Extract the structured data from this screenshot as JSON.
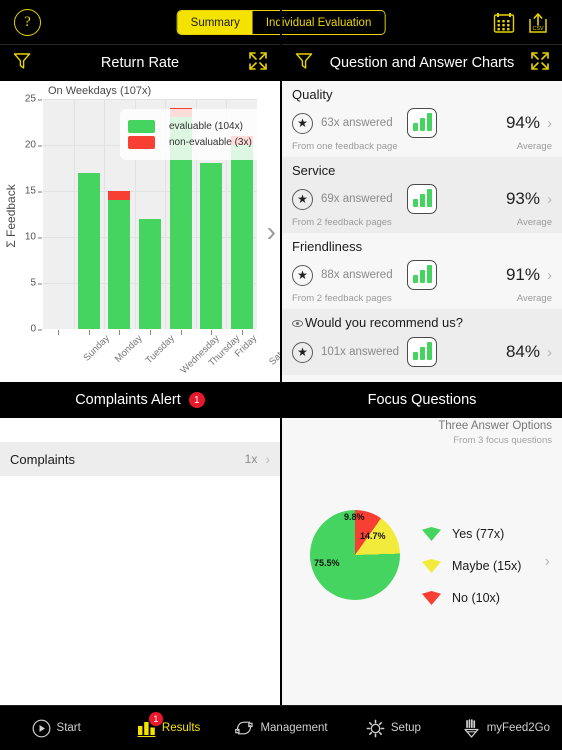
{
  "topbar": {
    "help_label": "?",
    "segments": [
      {
        "label": "Summary",
        "active": true
      },
      {
        "label": "Individual Evaluation",
        "active": false
      }
    ],
    "calendar_icon": "calendar-icon",
    "csv_icon": "csv-export-icon",
    "accent": "#F4E300"
  },
  "left_panel": {
    "header_title": "Return Rate",
    "filter_icon": "funnel-icon",
    "expand_icon": "expand-icon",
    "next_chevron": "›"
  },
  "right_panel": {
    "header_title": "Question and Answer Charts",
    "filter_icon": "funnel-icon",
    "expand_icon": "expand-icon"
  },
  "chart_data": {
    "type": "bar",
    "title": "On Weekdays (107x)",
    "xlabel": "",
    "ylabel": "Σ Feedback",
    "categories": [
      "Sunday",
      "Monday",
      "Tuesday",
      "Wednesday",
      "Thursday",
      "Friday",
      "Saturday"
    ],
    "series": [
      {
        "name": "evaluable (104x)",
        "color": "#45D45F",
        "values": [
          0,
          17,
          14,
          12,
          23,
          18,
          20
        ]
      },
      {
        "name": "non-evaluable (3x)",
        "color": "#F73F33",
        "values": [
          0,
          0,
          1,
          0,
          1,
          0,
          1
        ]
      }
    ],
    "stacked": true,
    "ylim": [
      0,
      25
    ],
    "yticks": [
      0,
      5,
      10,
      15,
      20,
      25
    ],
    "grid": true,
    "legend_position": "top-right",
    "legend": [
      "evaluable (104x)",
      "non-evaluable (3x)"
    ]
  },
  "questions": [
    {
      "name": "Quality",
      "answered": "63x answered",
      "percent": "94%",
      "source": "From one feedback page",
      "average_label": "Average",
      "chart_icon": "bar-chart-icon",
      "star_icon": "star-icon",
      "chevron": "›",
      "has_eye": false
    },
    {
      "name": "Service",
      "answered": "69x answered",
      "percent": "93%",
      "source": "From 2 feedback pages",
      "average_label": "Average",
      "chart_icon": "bar-chart-icon",
      "star_icon": "star-icon",
      "chevron": "›",
      "has_eye": false
    },
    {
      "name": "Friendliness",
      "answered": "88x answered",
      "percent": "91%",
      "source": "From 2 feedback pages",
      "average_label": "Average",
      "chart_icon": "bar-chart-icon",
      "star_icon": "star-icon",
      "chevron": "›",
      "has_eye": false
    },
    {
      "name": "Would you recommend us?",
      "answered": "101x answered",
      "percent": "84%",
      "source": "",
      "average_label": "",
      "chart_icon": "bar-chart-icon",
      "star_icon": "star-icon",
      "chevron": "›",
      "has_eye": true
    }
  ],
  "complaints_panel": {
    "header_title": "Complaints Alert",
    "badge": "1",
    "rows": [
      {
        "label": "Complaints",
        "count": "1x",
        "chevron": "›"
      }
    ]
  },
  "focus_panel": {
    "header_title": "Focus Questions",
    "title": "Three Answer Options",
    "subtitle": "From 3 focus questions",
    "chevron": "›"
  },
  "pie_chart": {
    "type": "pie",
    "title": "Three Answer Options",
    "subtitle": "From 3 focus questions",
    "slices": [
      {
        "label": "Yes (77x)",
        "value": 75.5,
        "display": "75.5%",
        "count": 77,
        "color": "#45D45F"
      },
      {
        "label": "Maybe (15x)",
        "value": 14.7,
        "display": "14.7%",
        "count": 15,
        "color": "#F3EB3C"
      },
      {
        "label": "No (10x)",
        "value": 9.8,
        "display": "9.8%",
        "count": 10,
        "color": "#F73F33"
      }
    ]
  },
  "tabbar": {
    "items": [
      {
        "label": "Start",
        "icon": "play-circle-icon",
        "active": false,
        "badge": ""
      },
      {
        "label": "Results",
        "icon": "bar-chart-icon",
        "active": true,
        "badge": "1"
      },
      {
        "label": "Management",
        "icon": "refresh-icon",
        "active": false,
        "badge": ""
      },
      {
        "label": "Setup",
        "icon": "gear-icon",
        "active": false,
        "badge": ""
      },
      {
        "label": "myFeed2Go",
        "icon": "hand-heart-icon",
        "active": false,
        "badge": ""
      }
    ]
  }
}
